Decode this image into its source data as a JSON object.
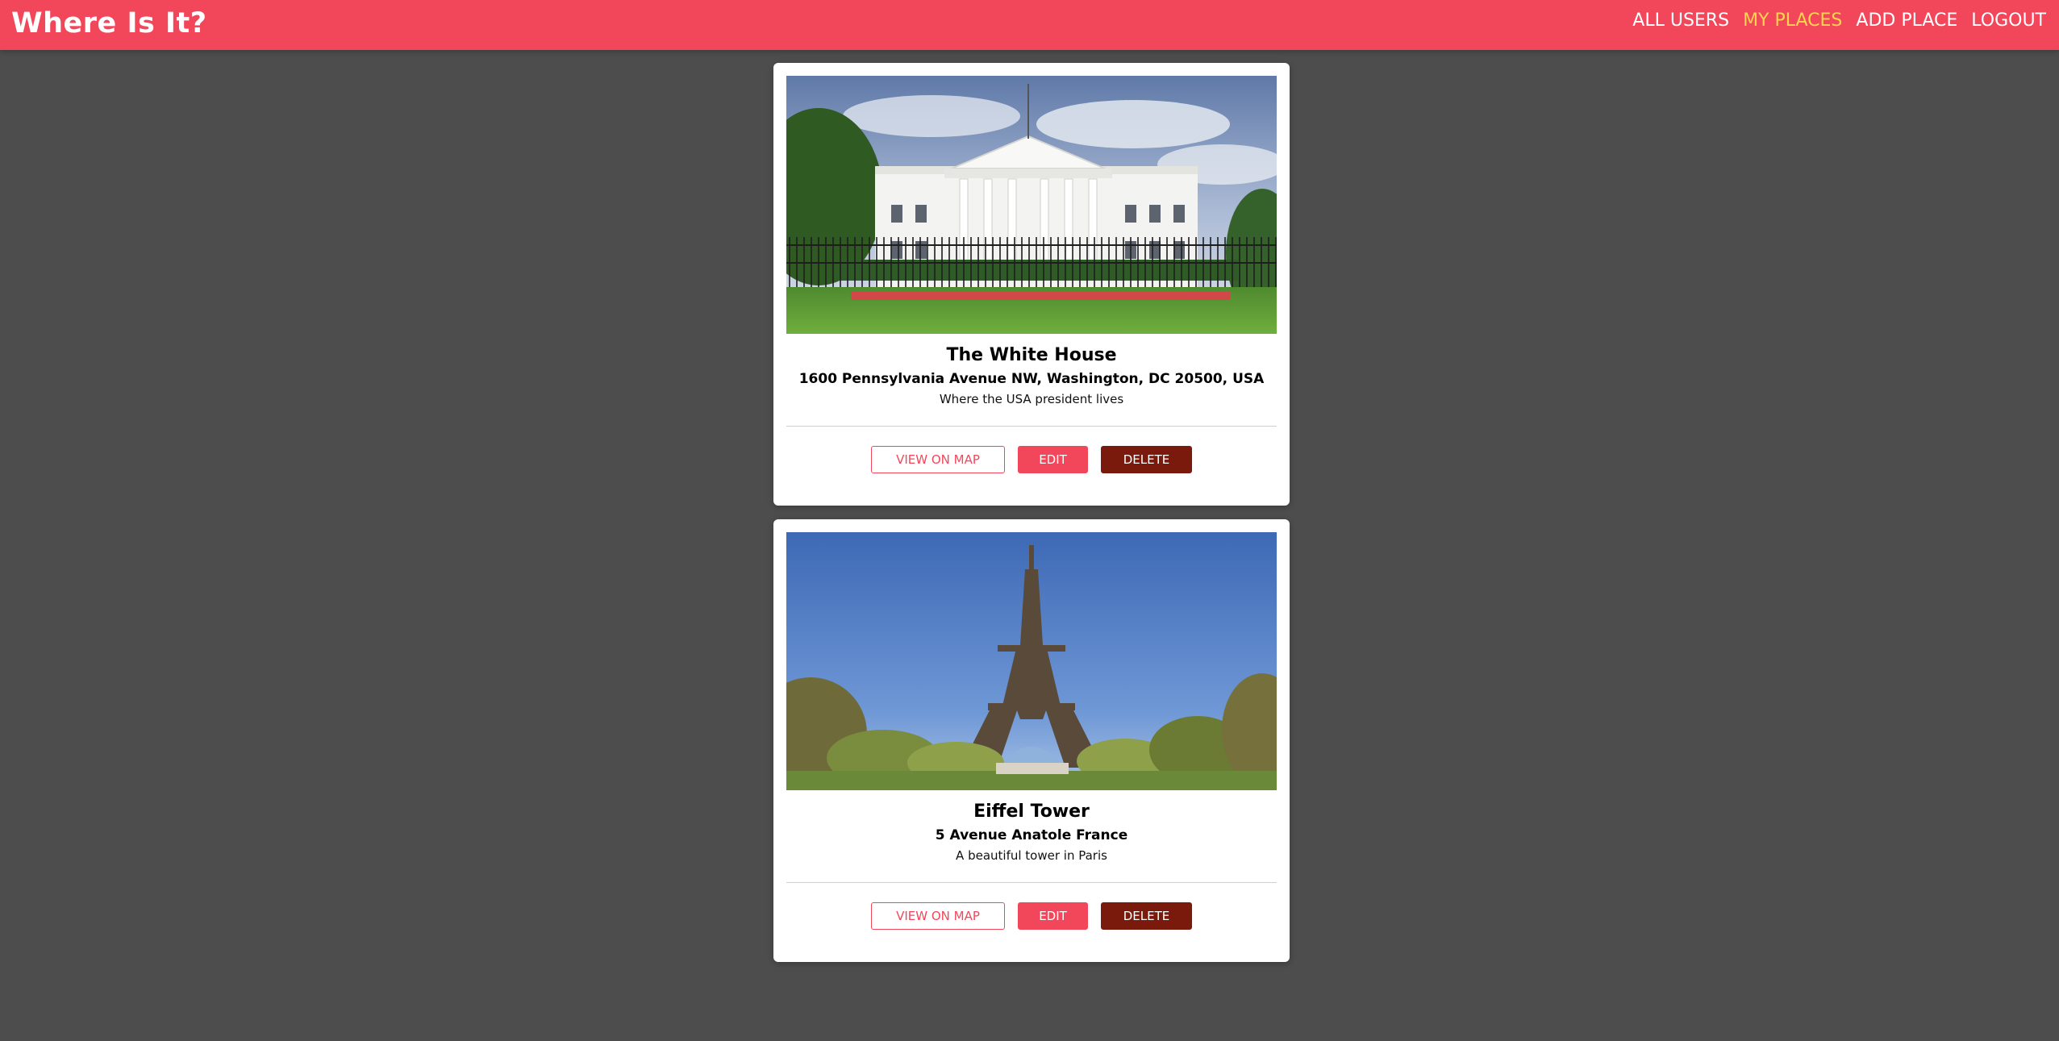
{
  "app": {
    "title": "Where Is It?"
  },
  "nav": {
    "items": [
      {
        "label": "ALL USERS",
        "active": false
      },
      {
        "label": "MY PLACES",
        "active": true
      },
      {
        "label": "ADD PLACE",
        "active": false
      },
      {
        "label": "LOGOUT",
        "active": false
      }
    ]
  },
  "colors": {
    "header": "#f2475b",
    "active_nav": "#ffd34f",
    "background": "#4d4d4d",
    "delete_button": "#7a1a0c"
  },
  "places": [
    {
      "title": "The White House",
      "address": "1600 Pennsylvania Avenue NW, Washington, DC 20500, USA",
      "description": "Where the USA president lives",
      "image": "white-house-photo",
      "buttons": {
        "view": "VIEW ON MAP",
        "edit": "EDIT",
        "delete": "DELETE"
      }
    },
    {
      "title": "Eiffel Tower",
      "address": "5 Avenue Anatole France",
      "description": "A beautiful tower in Paris",
      "image": "eiffel-tower-photo",
      "buttons": {
        "view": "VIEW ON MAP",
        "edit": "EDIT",
        "delete": "DELETE"
      }
    }
  ]
}
